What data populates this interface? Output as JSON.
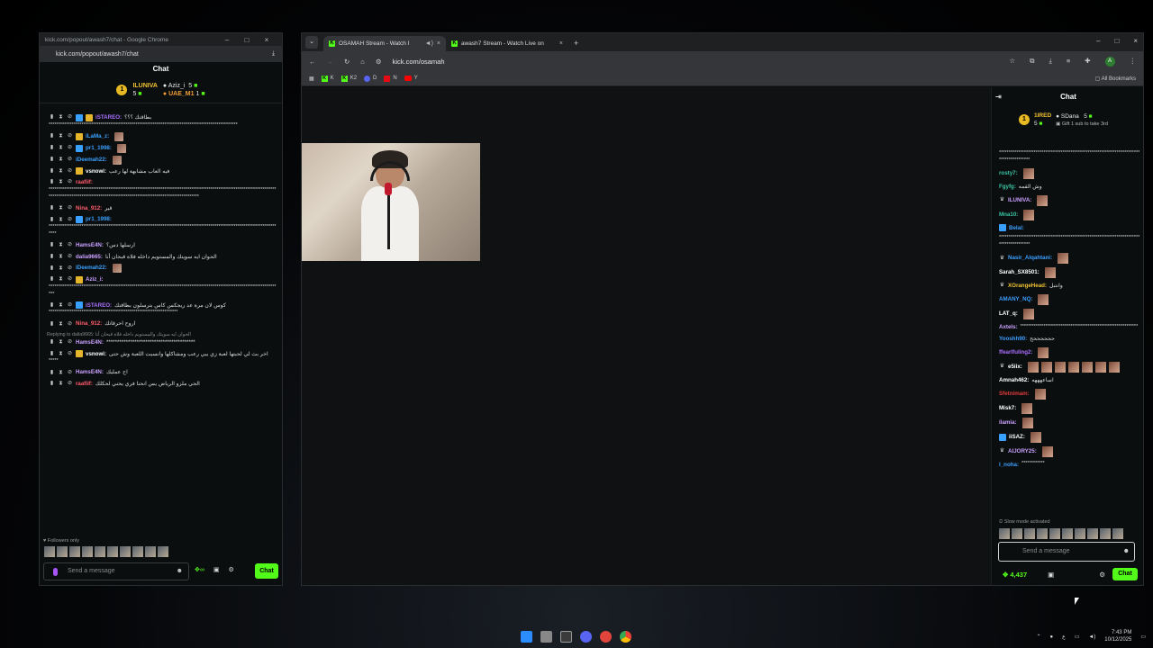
{
  "popout": {
    "window_title": "kick.com/popout/awash7/chat - Google Chrome",
    "url": "kick.com/popout/awash7/chat",
    "chat_title": "Chat",
    "pinned": {
      "rank1_user": "ILUNIVA",
      "rank1_count": "5",
      "rank2_user": "Aziz_i",
      "rank2_count": "5",
      "rank3_user": "UAE_M1",
      "rank3_count": "1",
      "rank_badge": "1"
    },
    "messages": [
      {
        "user": "iSTAREO:",
        "color": "#a970ff",
        "text": "بطاقتك ؟؟؟",
        "body": "**************************************************************************************************"
      },
      {
        "user": "iLaMa_z:",
        "color": "#3aa0ff",
        "text": "",
        "body": ""
      },
      {
        "user": "pr1_1998:",
        "color": "#3aa0ff",
        "text": "",
        "body": ""
      },
      {
        "user": "iDeemah22:",
        "color": "#3aa0ff",
        "text": "",
        "body": ""
      },
      {
        "user": "vsnowi:",
        "color": "#ffffff",
        "text": "فيه العاب مشابهة لها رعب",
        "body": ""
      },
      {
        "user": "raafiif:",
        "color": "#ff5c6c",
        "text": "",
        "body": "****************************************************************************************************************************************************************************************************"
      },
      {
        "user": "Nina_912:",
        "color": "#ff5c6c",
        "text": "قير",
        "body": ""
      },
      {
        "user": "pr1_1998:",
        "color": "#3aa0ff",
        "text": "",
        "body": "**************************************************************************************************************************"
      },
      {
        "user": "HamsE4N:",
        "color": "#c9a0ff",
        "text": "ارسلها دس؟",
        "body": ""
      },
      {
        "user": "dalia9665:",
        "color": "#c9a0ff",
        "text": "الحوان ايه سويتك والمستويم داخله فلاة قبحان أنا",
        "body": ""
      },
      {
        "user": "iDeemah22:",
        "color": "#3aa0ff",
        "text": "",
        "body": ""
      },
      {
        "user": "Aziz_i:",
        "color": "#c9a0ff",
        "text": "",
        "body": "*************************************************************************************************************************"
      },
      {
        "user": "iSTAREO:",
        "color": "#a970ff",
        "text": "كوس لان مرة عد ريجكس كاس بترسلون بطاقتك",
        "body": "*******************************************************************"
      },
      {
        "user": "Nina_912:",
        "color": "#ff5c6c",
        "text": "اروح احرقاتك",
        "body": ""
      },
      {
        "user": "HamsE4N:",
        "color": "#c9a0ff",
        "text": "*****************************************",
        "body": "",
        "reply": "Replying to dalia9665: الحوان ايه سويتك والمستويم داخله فلاة قبحان أنا"
      },
      {
        "user": "vsnowi:",
        "color": "#ffffff",
        "text": "اخر بث لي لحبتها لعبة زي يبي رعب ومشاكلها وانسيت اللعبة وش حتى",
        "body": "*****"
      },
      {
        "user": "HamsE4N:",
        "color": "#c9a0ff",
        "text": "اح عمليك",
        "body": ""
      },
      {
        "user": "raafiif:",
        "color": "#ff5c6c",
        "text": "الحي ملزو الرياض يس انحنا فري يحني لحكلك",
        "body": ""
      }
    ],
    "status": "Followers only",
    "input_placeholder": "Send a message",
    "chat_button": "Chat"
  },
  "browser": {
    "tabs": [
      {
        "label": "OSAMAH Stream - Watch l"
      },
      {
        "label": "awash7 Stream - Watch Live on"
      }
    ],
    "url": "kick.com/osamah",
    "bookmarks": [
      {
        "label": "K",
        "kind": "k"
      },
      {
        "label": "K2",
        "kind": "k"
      },
      {
        "label": "D",
        "kind": "d"
      },
      {
        "label": "N",
        "kind": "n"
      },
      {
        "label": "Y",
        "kind": "y"
      }
    ],
    "all_bookmarks": "All Bookmarks",
    "avatar_letter": "A"
  },
  "right_chat": {
    "title": "Chat",
    "pinned": {
      "rank1_user": "1IRED",
      "rank1_count": "5",
      "rank2_user": "SDana",
      "rank2_count": "5",
      "sub_text": "Gift 1 sub to take 3rd",
      "rank_badge": "1"
    },
    "messages": [
      {
        "user": "",
        "color": "#ffffff",
        "text": "*****************************************************************************************"
      },
      {
        "user": "rosty7:",
        "color": "#3ac5a5",
        "text": ""
      },
      {
        "user": "Fgyfg:",
        "color": "#3ac5a5",
        "text": "وش القمه"
      },
      {
        "user": "ILUNIVA:",
        "color": "#c9a0ff",
        "text": ""
      },
      {
        "user": "Mna10:",
        "color": "#3ac5a5",
        "text": ""
      },
      {
        "user": "Belal:",
        "color": "#3aa0ff",
        "text": "*****************************************************************************************"
      },
      {
        "user": "Nasir_Alqahtani:",
        "color": "#3aa0ff",
        "text": ""
      },
      {
        "user": "Sarah_SX8501:",
        "color": "#ffffff",
        "text": ""
      },
      {
        "user": "XOrangeHead:",
        "color": "#f0c232",
        "text": "وانتبل"
      },
      {
        "user": "AMANY_NQ:",
        "color": "#3aa0ff",
        "text": ""
      },
      {
        "user": "LAT_q:",
        "color": "#ffffff",
        "text": ""
      },
      {
        "user": "Axtels:",
        "color": "#c9a0ff",
        "text": "*************************************************************"
      },
      {
        "user": "Yooshh90:",
        "color": "#3aa0ff",
        "text": "ححححححح"
      },
      {
        "user": "ffearlfuling2:",
        "color": "#a970ff",
        "text": ""
      },
      {
        "user": "e5iix:",
        "color": "#ffffff",
        "text": ""
      },
      {
        "user": "Amnah462:",
        "color": "#ffffff",
        "text": "اساعهههه"
      },
      {
        "user": "Sfetnimam:",
        "color": "#e23b3b",
        "text": ""
      },
      {
        "user": "Misk7:",
        "color": "#ffffff",
        "text": ""
      },
      {
        "user": "ilamia:",
        "color": "#c9a0ff",
        "text": ""
      },
      {
        "user": "iiSAZ:",
        "color": "#ffffff",
        "text": ""
      },
      {
        "user": "AIJORY25:",
        "color": "#c9a0ff",
        "text": ""
      },
      {
        "user": "l_noha:",
        "color": "#3aa0ff",
        "text": "************"
      }
    ],
    "status": "Slow mode activated",
    "input_placeholder": "Send a message",
    "points": "4,437",
    "chat_button": "Chat"
  },
  "taskbar": {
    "time": "7:43 PM",
    "date": "10/12/2025"
  }
}
